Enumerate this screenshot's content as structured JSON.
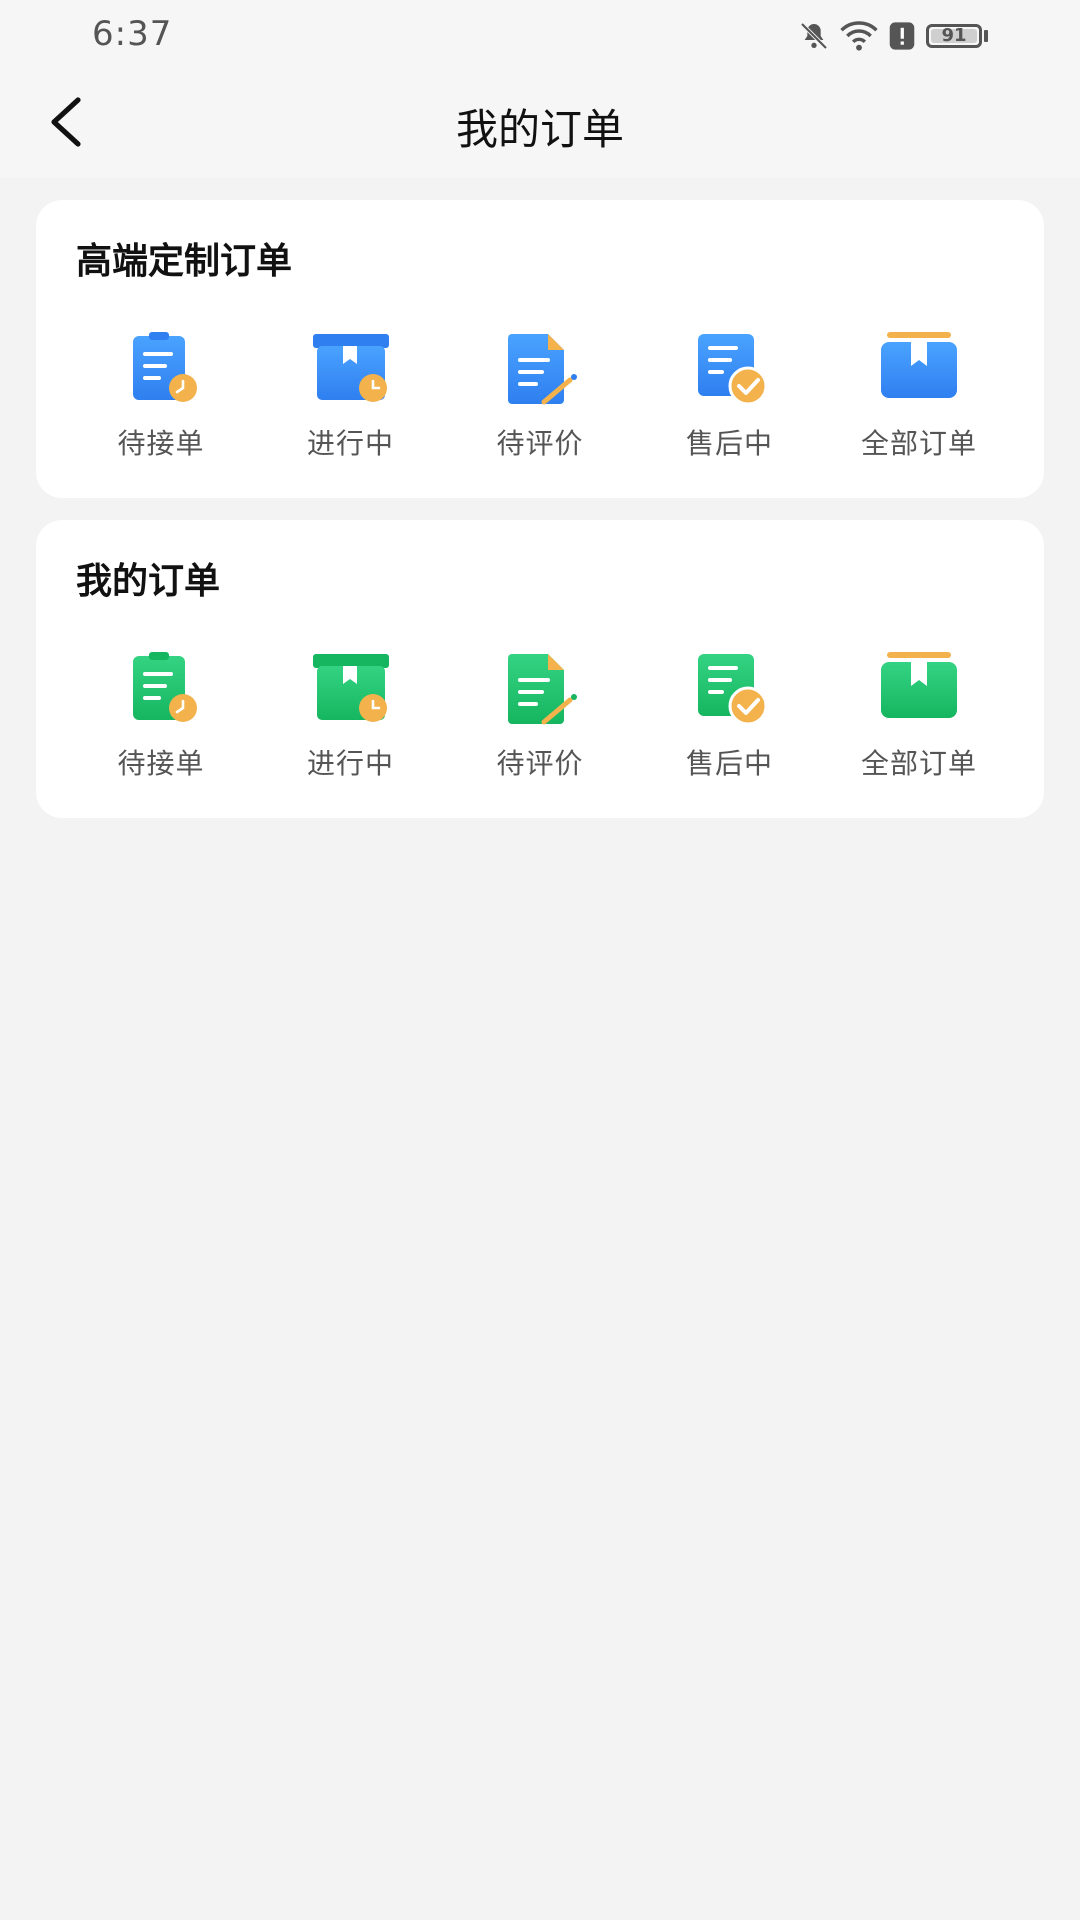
{
  "status_bar": {
    "time": "6:37",
    "battery": "91",
    "icons": [
      "bell-off-icon",
      "wifi-icon",
      "alert-icon",
      "battery-icon"
    ]
  },
  "header": {
    "title": "我的订单",
    "back_icon": "chevron-left-icon"
  },
  "colors": {
    "blue_primary": "#3d8ff5",
    "green_primary": "#21c46e",
    "orange_badge": "#f3b24c"
  },
  "sections": [
    {
      "title": "高端定制订单",
      "theme": "blue",
      "items": [
        {
          "label": "待接单",
          "icon": "pending-clipboard-icon"
        },
        {
          "label": "进行中",
          "icon": "in-progress-box-icon"
        },
        {
          "label": "待评价",
          "icon": "review-document-icon"
        },
        {
          "label": "售后中",
          "icon": "after-sale-check-icon"
        },
        {
          "label": "全部订单",
          "icon": "all-orders-box-icon"
        }
      ]
    },
    {
      "title": "我的订单",
      "theme": "green",
      "items": [
        {
          "label": "待接单",
          "icon": "pending-clipboard-icon"
        },
        {
          "label": "进行中",
          "icon": "in-progress-box-icon"
        },
        {
          "label": "待评价",
          "icon": "review-document-icon"
        },
        {
          "label": "售后中",
          "icon": "after-sale-check-icon"
        },
        {
          "label": "全部订单",
          "icon": "all-orders-box-icon"
        }
      ]
    }
  ]
}
